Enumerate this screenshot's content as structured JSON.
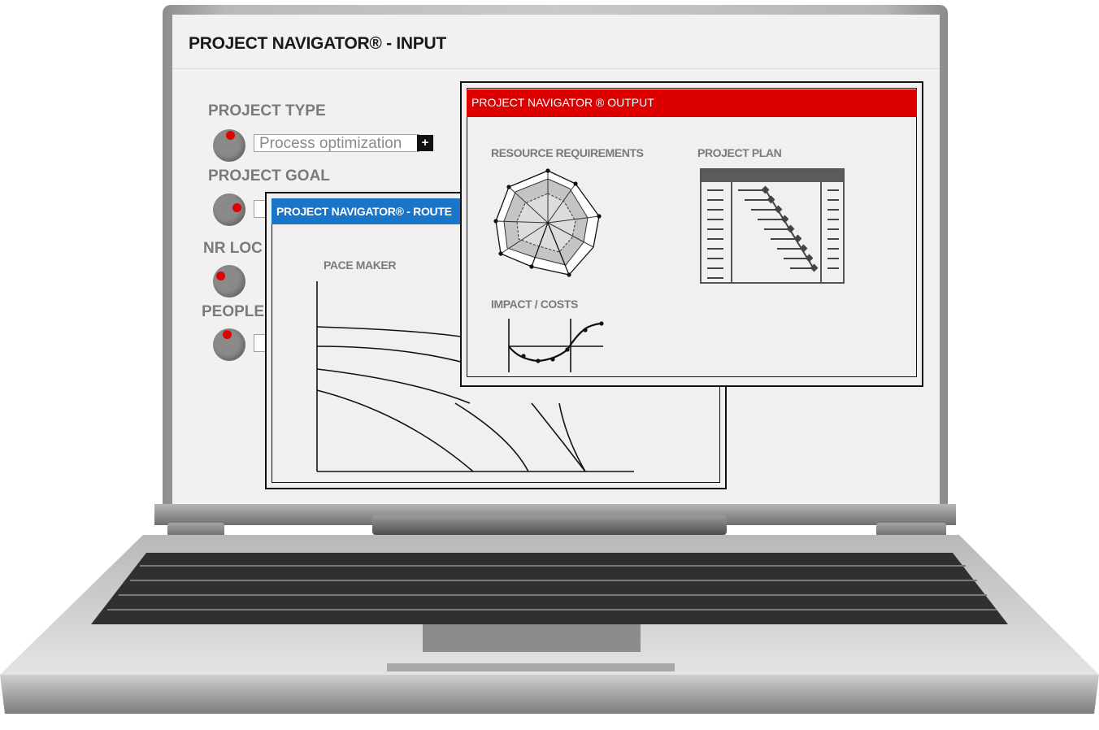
{
  "input": {
    "title": "PROJECT NAVIGATOR® - INPUT",
    "fields": [
      {
        "label": "PROJECT TYPE",
        "value": "Process optimization"
      },
      {
        "label": "PROJECT GOAL",
        "value": ""
      },
      {
        "label": "NR LOC",
        "value": ""
      },
      {
        "label": "PEOPLE",
        "value": ""
      }
    ],
    "add_label": "+"
  },
  "route": {
    "title": "PROJECT NAVIGATOR® - ROUTE",
    "pace_maker": "PACE MAKER",
    "title_color": "#1a75c8"
  },
  "output": {
    "title": "PROJECT NAVIGATOR ® OUTPUT",
    "title_color": "#dd0000",
    "resource_requirements": "RESOURCE REQUIREMENTS",
    "project_plan": "PROJECT PLAN",
    "impact_costs": "IMPACT / COSTS"
  },
  "colors": {
    "knob_dot": "#e00000",
    "knob": "#8a8a8a"
  }
}
